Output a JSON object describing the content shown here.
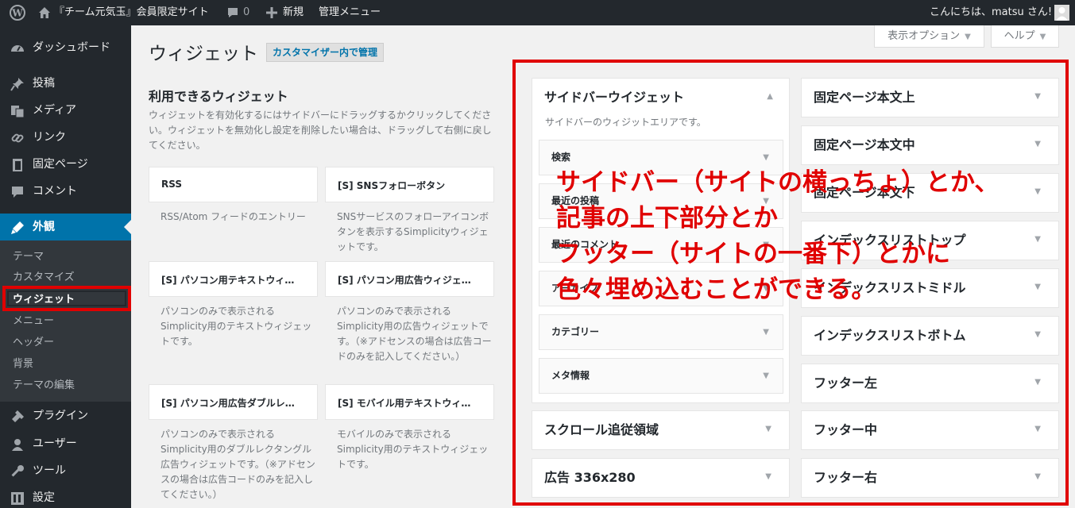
{
  "adminbar": {
    "site_name": "『チーム元気玉』会員限定サイト",
    "comments_count": "0",
    "new_label": "新規",
    "admin_menu_label": "管理メニュー",
    "greeting": "こんにちは、matsu さん!"
  },
  "sidebar": {
    "items": [
      {
        "label": "ダッシュボード",
        "icon": "dashboard-icon"
      },
      {
        "label": "投稿",
        "icon": "pin-icon"
      },
      {
        "label": "メディア",
        "icon": "media-icon"
      },
      {
        "label": "リンク",
        "icon": "link-icon"
      },
      {
        "label": "固定ページ",
        "icon": "page-icon"
      },
      {
        "label": "コメント",
        "icon": "comment-icon"
      },
      {
        "label": "外観",
        "icon": "appearance-icon"
      },
      {
        "label": "プラグイン",
        "icon": "plugin-icon"
      },
      {
        "label": "ユーザー",
        "icon": "user-icon"
      },
      {
        "label": "ツール",
        "icon": "tool-icon"
      },
      {
        "label": "設定",
        "icon": "settings-icon"
      }
    ],
    "submenu": [
      "テーマ",
      "カスタマイズ",
      "ウィジェット",
      "メニュー",
      "ヘッダー",
      "背景",
      "テーマの編集"
    ]
  },
  "screen_options": {
    "display_options": "表示オプション",
    "help": "ヘルプ"
  },
  "page": {
    "title": "ウィジェット",
    "manage_button": "カスタマイザー内で管理",
    "available_title": "利用できるウィジェット",
    "available_desc": "ウィジェットを有効化するにはサイドバーにドラッグするかクリックしてください。ウィジェットを無効化し設定を削除したい場合は、ドラッグして右側に戻してください。"
  },
  "widgets": [
    {
      "name": "RSS",
      "desc": "RSS/Atom フィードのエントリー"
    },
    {
      "name": "[S] SNSフォローボタン",
      "desc": "SNSサービスのフォローアイコンボタンを表示するSimplicityウィジェットです。"
    },
    {
      "name": "[S] パソコン用テキストウィ…",
      "desc": "パソコンのみで表示されるSimplicity用のテキストウィジェットです。"
    },
    {
      "name": "[S] パソコン用広告ウィジェ…",
      "desc": "パソコンのみで表示されるSimplicity用の広告ウィジェットです。（※アドセンスの場合は広告コードのみを記入してください。）"
    },
    {
      "name": "[S] パソコン用広告ダブルレ…",
      "desc": "パソコンのみで表示されるSimplicity用のダブルレクタングル広告ウィジェットです。（※アドセンスの場合は広告コードのみを記入してください。）"
    },
    {
      "name": "[S] モバイル用テキストウィ…",
      "desc": "モバイルのみで表示されるSimplicity用のテキストウィジェットです。"
    }
  ],
  "sidebar_widget_area": {
    "title": "サイドバーウイジェット",
    "desc": "サイドバーのウィジットエリアです。",
    "widgets": [
      "検索",
      "最近の投稿",
      "最近のコメント",
      "アーカイブ",
      "カテゴリー",
      "メタ情報"
    ]
  },
  "left_areas": [
    "スクロール追従領域",
    "広告 336x280"
  ],
  "right_areas": [
    "固定ページ本文上",
    "固定ページ本文中",
    "固定ページ本文下",
    "インデックスリストトップ",
    "インデックスリストミドル",
    "インデックスリストボトム",
    "フッター左",
    "フッター中",
    "フッター右"
  ],
  "annotation": {
    "line1": "サイドバー（サイトの横っちょ）とか、",
    "line2": "記事の上下部分とか",
    "line3": "フッター（サイトの一番下）とかに",
    "line4": "色々埋め込むことができる。"
  },
  "colors": {
    "accent": "#0073aa",
    "highlight": "#e00000",
    "adminbar": "#23282d"
  }
}
